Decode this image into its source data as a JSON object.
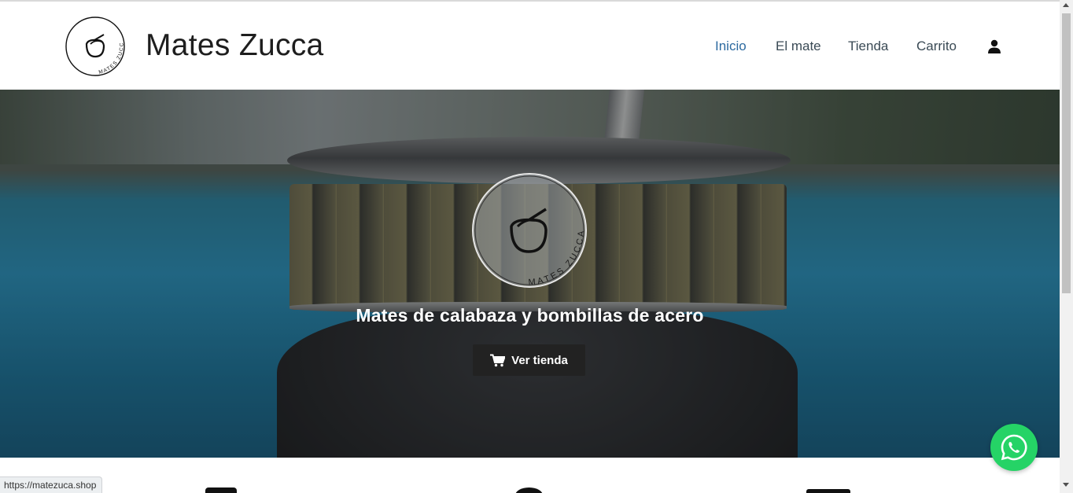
{
  "site": {
    "title": "Mates Zucca",
    "logo_text": "MATES ZUCCA"
  },
  "nav": {
    "items": [
      {
        "label": "Inicio",
        "active": true
      },
      {
        "label": "El mate",
        "active": false
      },
      {
        "label": "Tienda",
        "active": false
      },
      {
        "label": "Carrito",
        "active": false
      }
    ],
    "account_icon": "user-icon"
  },
  "hero": {
    "logo_text": "MATES ZUCCA",
    "heading": "Mates de calabaza y bombillas de acero",
    "button_label": "Ver tienda",
    "button_icon": "cart-icon"
  },
  "floating": {
    "whatsapp_icon": "whatsapp-icon",
    "whatsapp_color": "#25d366"
  },
  "status_bar": {
    "url": "https://matezuca.shop"
  },
  "colors": {
    "nav_active": "#2c6aa0",
    "nav_text": "#3a4a55",
    "button_bg": "#222222"
  }
}
